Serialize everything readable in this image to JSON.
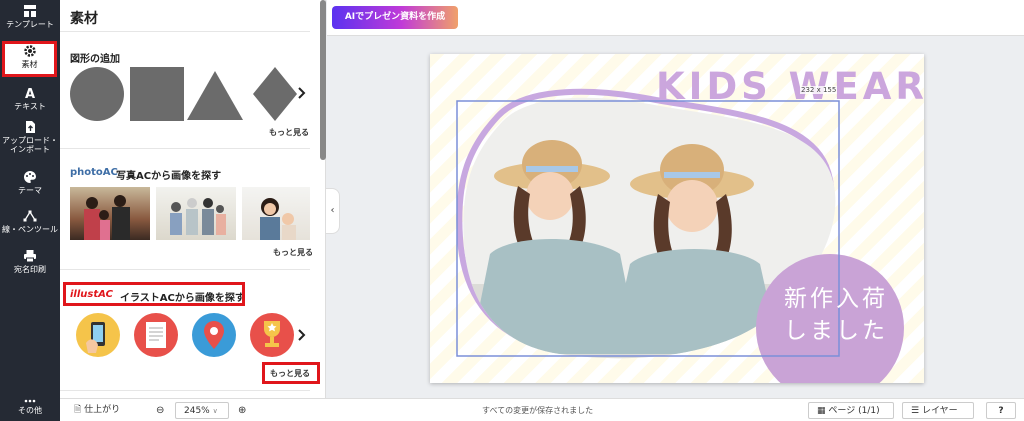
{
  "sidebar": {
    "items": [
      {
        "label": "テンプレート",
        "icon": "template-icon"
      },
      {
        "label": "素材",
        "icon": "gear-icon"
      },
      {
        "label": "テキスト",
        "icon": "text-icon"
      },
      {
        "label": "アップロード・インポート",
        "label2": "インポート",
        "label1": "アップロード・",
        "icon": "upload-icon"
      },
      {
        "label": "テーマ",
        "icon": "palette-icon"
      },
      {
        "label": "線・ペンツール",
        "icon": "pen-tool-icon"
      },
      {
        "label": "宛名印刷",
        "icon": "printer-icon"
      },
      {
        "label": "その他",
        "icon": "more-icon"
      }
    ]
  },
  "panel": {
    "title": "素材",
    "shapes": {
      "title": "図形の追加",
      "more": "もっと見る"
    },
    "photo": {
      "logo": "photoAC",
      "title": "写真ACから画像を探す",
      "more": "もっと見る"
    },
    "illust": {
      "logo": "illustAC",
      "title": "イラストACから画像を探す",
      "more": "もっと見る"
    }
  },
  "topbar": {
    "ai_button": "AIでプレゼン資料を作成"
  },
  "canvas": {
    "headline": "KIDS WEAR",
    "blob_line1": "新作入荷",
    "blob_line2": "しました",
    "selection_size": "232 x 155"
  },
  "bottombar": {
    "finish": "仕上がり",
    "zoom": "245%",
    "status": "すべての変更が保存されました",
    "pages": "ページ (1/1)",
    "layers": "レイヤー",
    "help": "?"
  },
  "colors": {
    "accent_red": "#e0161b",
    "headline": "#cba6dd",
    "blob": "#c9a3d6",
    "rail": "#252a34"
  }
}
